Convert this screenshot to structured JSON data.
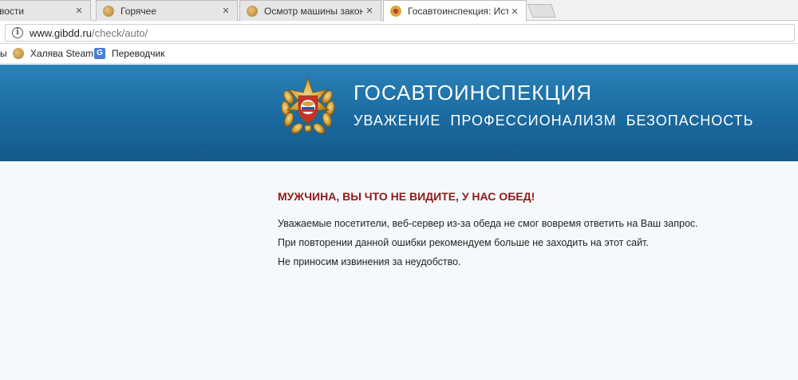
{
  "tabs": [
    {
      "label": "вости",
      "close": "✕"
    },
    {
      "label": "Горячее",
      "close": "✕"
    },
    {
      "label": "Осмотр машины закон",
      "close": "✕"
    },
    {
      "label": "Госавтоинспекция: Исто",
      "close": "✕"
    }
  ],
  "address": {
    "domain": "www.gibdd.ru",
    "path": "/check/auto/"
  },
  "bookmarks": [
    {
      "label": "ы",
      "icon": "partial"
    },
    {
      "label": "Халява Steam",
      "icon": "steam-icon"
    },
    {
      "label": "Переводчик",
      "icon": "translate-icon",
      "glyph": "G"
    }
  ],
  "header": {
    "title": "ГОСАВТОИНСПЕКЦИЯ",
    "subtitle": "УВАЖЕНИЕ ПРОФЕССИОНАЛИЗМ БЕЗОПАСНОСТЬ"
  },
  "content": {
    "title": "МУЖЧИНА, ВЫ ЧТО НЕ ВИДИТЕ, У НАС ОБЕД!",
    "lines": [
      "Уважаемые посетители, веб-сервер из-за обеда не смог вовремя ответить на Ваш запрос.",
      "При повторении данной ошибки рекомендуем больше не заходить на этот сайт.",
      "Не приносим извинения за неудобство."
    ]
  },
  "colors": {
    "banner": "#1a6aa0",
    "error_title": "#8f1a1a",
    "background": "#f6f9fb"
  }
}
